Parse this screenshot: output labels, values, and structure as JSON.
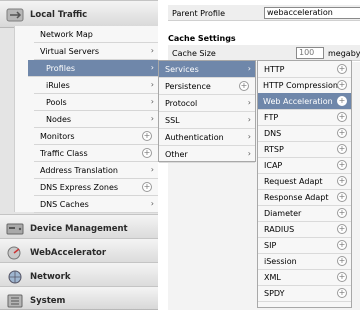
{
  "nav": {
    "local_traffic": "Local Traffic",
    "l2_items": [
      {
        "label": "Network Map"
      },
      {
        "label": "Virtual Servers"
      },
      {
        "label": "Profiles"
      },
      {
        "label": "iRules"
      },
      {
        "label": "Pools"
      },
      {
        "label": "Nodes"
      },
      {
        "label": "Monitors"
      },
      {
        "label": "Traffic Class"
      },
      {
        "label": "Address Translation"
      },
      {
        "label": "DNS Express Zones"
      },
      {
        "label": "DNS Caches"
      }
    ],
    "device_management": "Device Management",
    "webaccelerator": "WebAccelerator",
    "network": "Network",
    "system": "System"
  },
  "main": {
    "parent_profile_label": "Parent Profile",
    "parent_profile_value": "webacceleration",
    "cache_settings": "Cache Settings",
    "cache_size_label": "Cache Size",
    "cache_size_value": "100",
    "cache_size_unit": "megabytes"
  },
  "profiles_menu": [
    "Services",
    "Persistence",
    "Protocol",
    "SSL",
    "Authentication",
    "Other"
  ],
  "services_menu": [
    "HTTP",
    "HTTP Compression",
    "Web Acceleration",
    "FTP",
    "DNS",
    "RTSP",
    "ICAP",
    "Request Adapt",
    "Response Adapt",
    "Diameter",
    "RADIUS",
    "SIP",
    "iSession",
    "XML",
    "SPDY"
  ],
  "colors": {
    "selected": "#6f87aa"
  }
}
